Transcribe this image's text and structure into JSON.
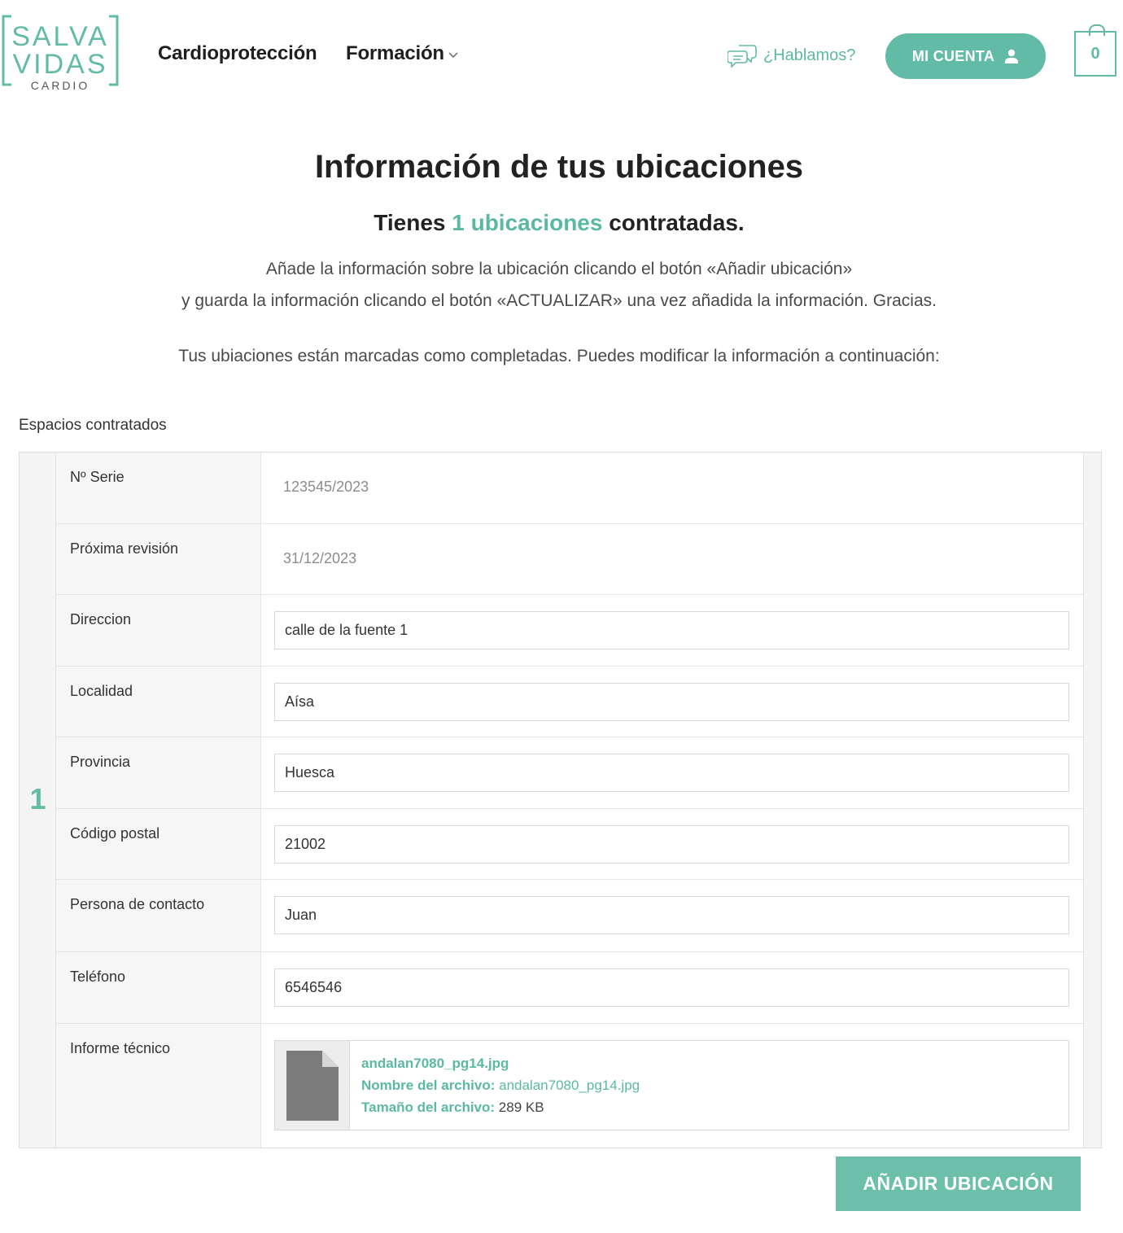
{
  "brand": {
    "line1": "SALVA",
    "line2": "VIDAS",
    "line3": "CARDIO",
    "accent_color": "#62bba6"
  },
  "nav": {
    "cardio": "Cardioprotección",
    "formacion": "Formación"
  },
  "header": {
    "hablamos": "¿Hablamos?",
    "account": "MI CUENTA",
    "cart_count": "0"
  },
  "intro": {
    "title": "Información de tus ubicaciones",
    "subtitle_pre": "Tienes ",
    "subtitle_accent": "1 ubicaciones",
    "subtitle_post": " contratadas.",
    "line1": "Añade la información sobre la ubicación clicando el botón «Añadir ubicación»",
    "line2": "y guarda la información clicando el botón «ACTUALIZAR» una vez añadida la información. Gracias.",
    "line3": "Tus ubiaciones están marcadas como completadas. Puedes modificar la información a continuación:"
  },
  "section_label": "Espacios contratados",
  "location": {
    "number": "1",
    "serie_label": "Nº Serie",
    "serie_value": "123545/2023",
    "revision_label": "Próxima revisión",
    "revision_value": "31/12/2023",
    "direccion_label": "Direccion",
    "direccion_value": "calle de la fuente 1",
    "localidad_label": "Localidad",
    "localidad_value": "Aísa",
    "provincia_label": "Provincia",
    "provincia_value": "Huesca",
    "cp_label": "Código postal",
    "cp_value": "21002",
    "contacto_label": "Persona de contacto",
    "contacto_value": "Juan",
    "telefono_label": "Teléfono",
    "telefono_value": "6546546",
    "informe_label": "Informe técnico",
    "file": {
      "name": "andalan7080_pg14.jpg",
      "name_label": "Nombre del archivo:",
      "name_value": "andalan7080_pg14.jpg",
      "size_label": "Tamaño del archivo:",
      "size_value": "289 KB"
    }
  },
  "add_button": "AÑADIR UBICACIÓN"
}
